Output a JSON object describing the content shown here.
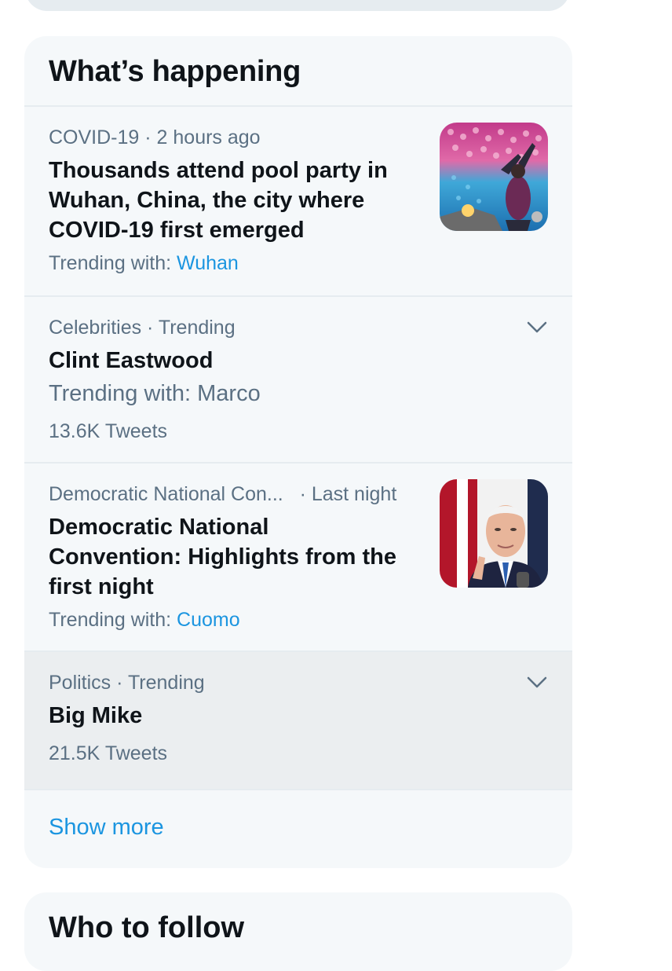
{
  "trends_panel": {
    "title": "What’s happening",
    "items": [
      {
        "category": "COVID-19",
        "time": "2 hours ago",
        "headline_lines": [
          "Thousands attend pool party in",
          "Wuhan, China, the city where",
          "COVID-19 first emerged"
        ],
        "trending_with_label": "Trending with:",
        "trending_with_link": "Wuhan",
        "thumbnail_desc": "pool-party-photo"
      },
      {
        "category": "Celebrities · Trending",
        "headline": "Clint Eastwood",
        "trending_with": "Trending with: Marco",
        "tweet_count": "13.6K Tweets",
        "icon": "chevron-down-icon"
      },
      {
        "category": "Democratic National Con...",
        "time": "Last night",
        "headline_lines": [
          "Democratic National",
          "Convention: Highlights from the",
          "first night"
        ],
        "trending_with_label": "Trending with:",
        "trending_with_link": "Cuomo",
        "thumbnail_desc": "speaker-photo"
      },
      {
        "category": "Politics · Trending",
        "headline": "Big Mike",
        "tweet_count": "21.5K Tweets",
        "icon": "chevron-down-icon"
      }
    ],
    "show_more": "Show more"
  },
  "follow_panel": {
    "title": "Who to follow"
  },
  "colors": {
    "accent": "#1b95e0",
    "secondary_text": "#5b7083",
    "panel_bg": "#f5f8fa",
    "hover_bg": "#ebeef0"
  }
}
